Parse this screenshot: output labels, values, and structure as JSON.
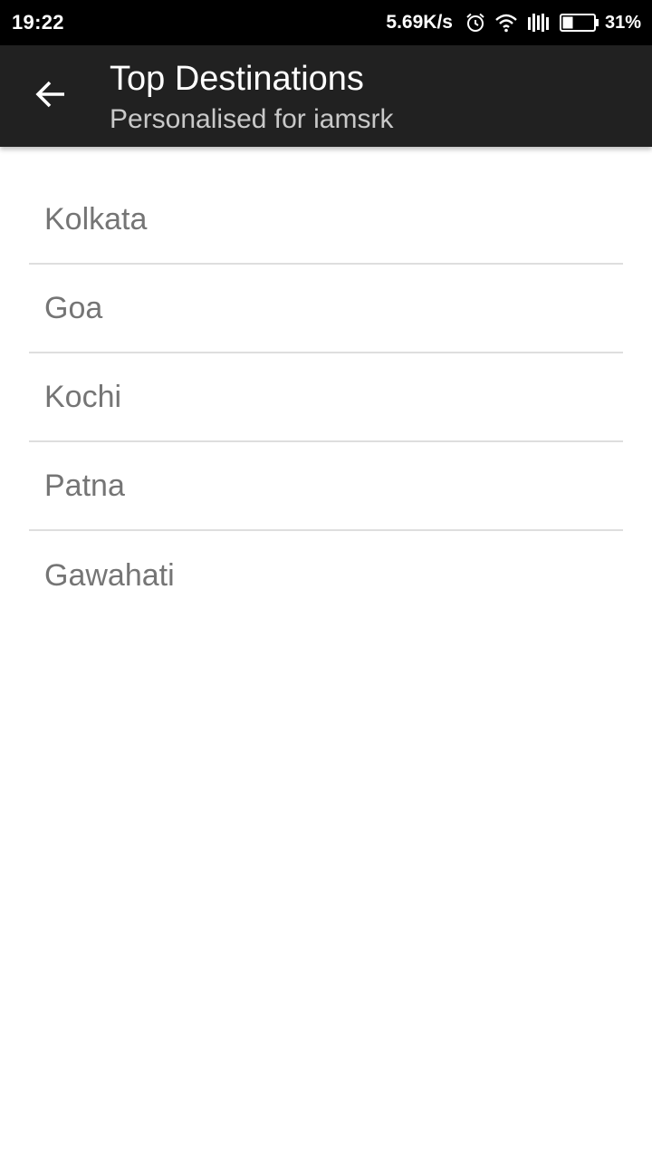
{
  "status_bar": {
    "time": "19:22",
    "net_speed": "5.69K/s",
    "battery": "31%",
    "icons": [
      "alarm-icon",
      "wifi-icon",
      "signal-icon",
      "battery-icon"
    ]
  },
  "app_bar": {
    "back_icon": "arrow-left-icon",
    "title": "Top Destinations",
    "subtitle": "Personalised for iamsrk"
  },
  "destinations": [
    {
      "label": "Kolkata"
    },
    {
      "label": "Goa"
    },
    {
      "label": "Kochi"
    },
    {
      "label": "Patna"
    },
    {
      "label": "Gawahati"
    }
  ],
  "colors": {
    "status_bar_bg": "#000000",
    "app_bar_bg": "#212121",
    "list_text": "#757575",
    "divider": "#dedede"
  }
}
